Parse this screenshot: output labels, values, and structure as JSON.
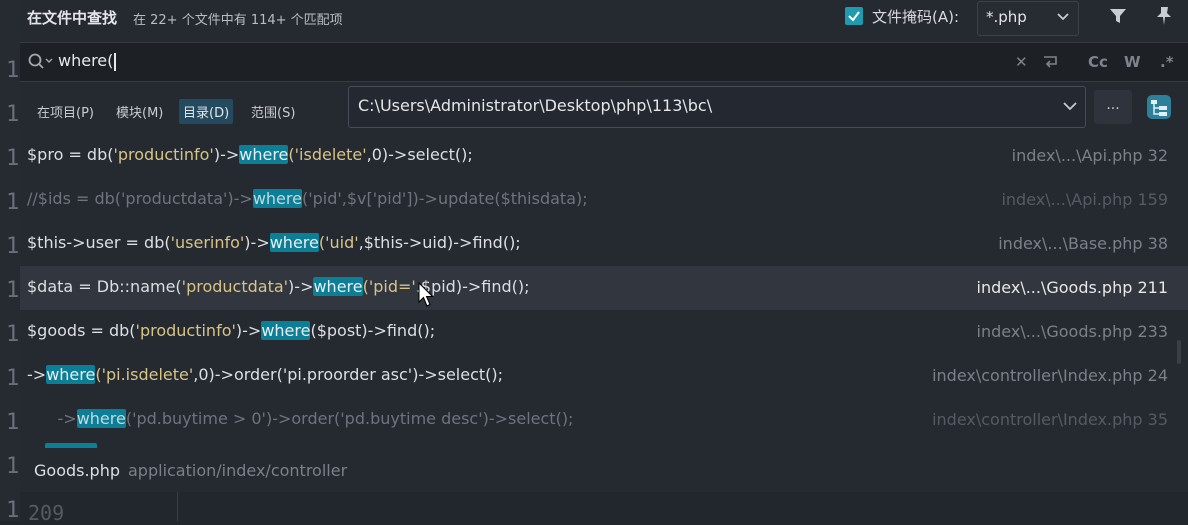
{
  "header": {
    "title": "在文件中查找",
    "summary": "在 22+ 个文件中有 114+ 个匹配项",
    "file_mask_label": "文件掩码(A):",
    "file_mask_checked": true,
    "file_mask_value": "*.php"
  },
  "search": {
    "query": "where(",
    "tools": {
      "match_case": "Cc",
      "whole_words": "W",
      "regex": ".*"
    }
  },
  "scope": {
    "options": [
      {
        "label": "在项目(P)",
        "selected": false
      },
      {
        "label": "模块(M)",
        "selected": false
      },
      {
        "label": "目录(D)",
        "selected": true
      },
      {
        "label": "范围(S)",
        "selected": false
      }
    ],
    "directory": "C:\\Users\\Administrator\\Desktop\\php\\113\\bc\\",
    "browse_label": "..."
  },
  "results": [
    {
      "pre": "$pro = db(",
      "s1": "'productinfo'",
      "mid": ")->",
      "match": "where",
      "post_s": "('isdelete'",
      "post": ",0)->select();",
      "file": "index\\...\\Api.php 32",
      "state": "normal"
    },
    {
      "pre": "//$ids = db('productdata')->",
      "s1": "",
      "mid": "",
      "match": "where",
      "post_s": "",
      "post": "('pid',$v['pid'])->update($thisdata);",
      "file": "index\\...\\Api.php 159",
      "state": "dim"
    },
    {
      "pre": "$this->user = db(",
      "s1": "'userinfo'",
      "mid": ")->",
      "match": "where",
      "post_s": "('uid'",
      "post": ",$this->uid)->find();",
      "file": "index\\...\\Base.php 38",
      "state": "normal"
    },
    {
      "pre": "$data = Db::name(",
      "s1": "'productdata'",
      "mid": ")->",
      "match": "where",
      "post_s": "('pid='",
      "post": ".$pid)->find();",
      "file": "index\\...\\Goods.php 211",
      "state": "selected"
    },
    {
      "pre": "$goods = db(",
      "s1": "'productinfo'",
      "mid": ")->",
      "match": "where",
      "post_s": "",
      "post": "($post)->find();",
      "file": "index\\...\\Goods.php 233",
      "state": "normal"
    },
    {
      "pre": "->",
      "s1": "",
      "mid": "",
      "match": "where",
      "post_s": "('pi.isdelete'",
      "post": ",0)->order('pi.proorder asc')->select();",
      "file": "index\\controller\\Index.php 24",
      "state": "normal"
    },
    {
      "pre": "      ->",
      "s1": "",
      "mid": "",
      "match": "where",
      "post_s": "",
      "post": "('pd.buytime > 0')->order('pd.buytime desc')->select();",
      "file": "index\\controller\\Index.php 35",
      "state": "dim"
    }
  ],
  "footer": {
    "file_name": "Goods.php",
    "file_path": "application/index/controller",
    "preview_line": "209"
  },
  "gutter": [
    "1",
    "1",
    "1",
    "1",
    "1",
    "1",
    "1",
    "1",
    "1",
    "1",
    "1"
  ],
  "colors": {
    "accent": "#0c7f97",
    "background": "#252a31",
    "selected_row": "#31363f"
  }
}
